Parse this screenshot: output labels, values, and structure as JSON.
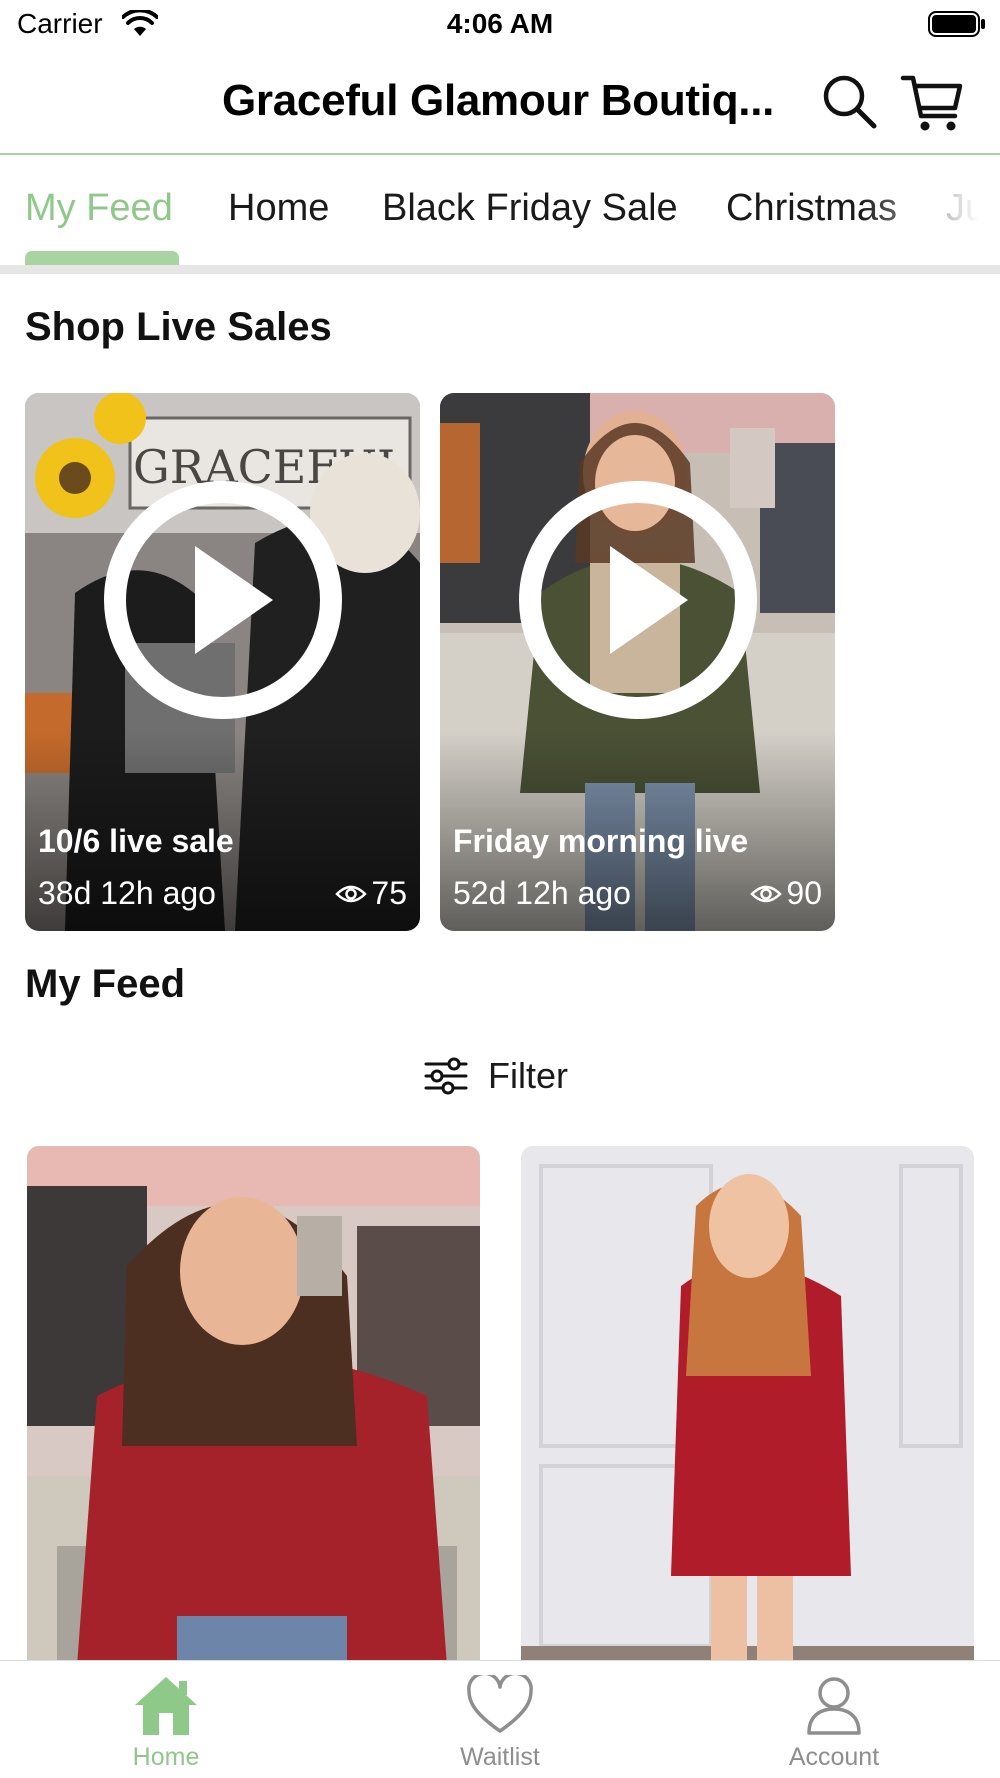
{
  "status_bar": {
    "carrier": "Carrier",
    "time": "4:06 AM"
  },
  "header": {
    "title": "Graceful Glamour Boutiq...",
    "icons": [
      "search-icon",
      "cart-icon"
    ]
  },
  "tabs": [
    {
      "label": "My Feed",
      "active": true
    },
    {
      "label": "Home",
      "active": false
    },
    {
      "label": "Black Friday Sale",
      "active": false
    },
    {
      "label": "Christmas",
      "active": false
    },
    {
      "label": "Ju",
      "active": false
    }
  ],
  "live_section": {
    "title": "Shop Live Sales",
    "cards": [
      {
        "title": "10/6 live sale",
        "ago": "38d 12h ago",
        "views": "75",
        "photo_text": "GRACEFUL GLAMOUR"
      },
      {
        "title": "Friday morning live",
        "ago": "52d 12h ago",
        "views": "90"
      }
    ]
  },
  "feed_section": {
    "title": "My Feed",
    "filter_label": "Filter"
  },
  "tab_bar": [
    {
      "label": "Home",
      "icon": "home-icon",
      "active": true
    },
    {
      "label": "Waitlist",
      "icon": "heart-icon",
      "active": false
    },
    {
      "label": "Account",
      "icon": "person-icon",
      "active": false
    }
  ],
  "colors": {
    "accent": "#8fc98a",
    "accent_light": "#a9d3a0",
    "inactive": "#8e8e8e"
  }
}
